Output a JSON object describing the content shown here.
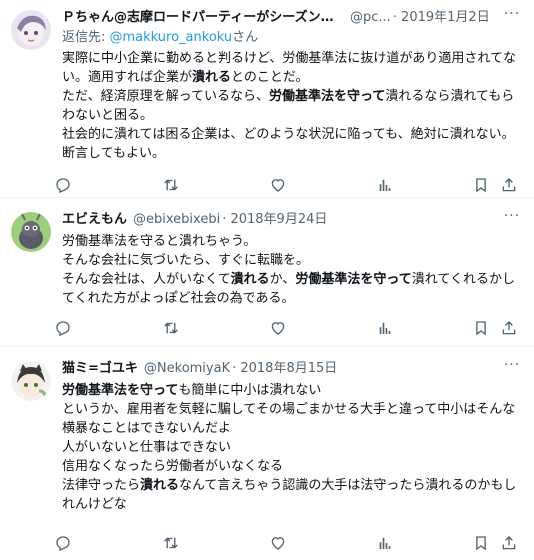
{
  "tweets": [
    {
      "name": "Ｐちゃん@志摩ロードパーティーがシーズン最…",
      "handle": "@pc...",
      "date": "· 2019年1月2日",
      "reply_prefix": "返信先: ",
      "reply_to": "@makkuro_ankoku",
      "reply_suffix": "さん",
      "lines": [
        [
          "実際に中小企業に勤めると判るけど、労働基準法に抜け道があり適用されてない。適用すれば企業が",
          {
            "b": "潰れる"
          },
          "とのことだ。"
        ],
        [
          "ただ、経済原理を解っているなら、",
          {
            "b": "労働基準法を守って"
          },
          "潰れるなら潰れてもらわないと困る。"
        ],
        [
          "社会的に潰れては困る企業は、どのような状況に陥っても、絶対に潰れない。断言してもよい。"
        ]
      ]
    },
    {
      "name": "エビえもん",
      "handle": "@ebixebixebi",
      "date": "· 2018年9月24日",
      "lines": [
        [
          "労働基準法を守ると潰れちゃう。"
        ],
        [
          "そんな会社に気づいたら、すぐに転職を。"
        ],
        [
          "そんな会社は、人がいなくて",
          {
            "b": "潰れる"
          },
          "か、",
          {
            "b": "労働基準法を守って"
          },
          "潰れてくれるかしてくれた方がよっぽど社会の為である。"
        ]
      ]
    },
    {
      "name": "猫ミ=ゴユキ",
      "handle": "@NekomiyaK",
      "date": "· 2018年8月15日",
      "lines": [
        [
          {
            "b": "労働基準法を守って"
          },
          "も簡単に中小は潰れない"
        ],
        [
          "というか、雇用者を気軽に騙してその場ごまかせる大手と違って中小はそんな横暴なことはできないんだよ"
        ],
        [
          "人がいないと仕事はできない"
        ],
        [
          "信用なくなったら労働者がいなくなる"
        ],
        [
          "法律守ったら",
          {
            "b": "潰れる"
          },
          "なんて言えちゃう認識の大手は法守ったら潰れるのかもしれんけどな"
        ]
      ]
    }
  ],
  "icons": {
    "more": "more-horizontal-icon",
    "reply": "reply-icon",
    "retweet": "retweet-icon",
    "like": "like-icon",
    "views": "views-icon",
    "bookmark": "bookmark-icon",
    "share": "share-icon"
  },
  "colors": {
    "text": "#0f1419",
    "secondary": "#536471",
    "link": "#1d9bf0",
    "divider": "#eff3f4"
  }
}
